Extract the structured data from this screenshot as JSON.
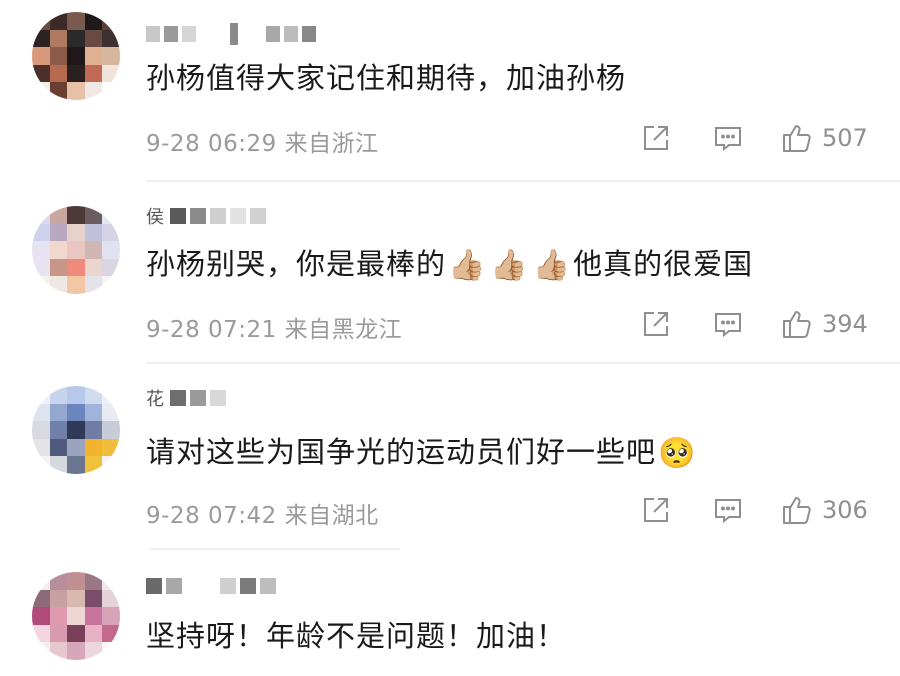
{
  "comments": [
    {
      "username": "",
      "text": "孙杨值得大家记住和期待，加油孙杨",
      "time": "9-28 06:29",
      "location": "来自浙江",
      "likes": "507",
      "emojis": []
    },
    {
      "username": "侯",
      "text_before": "孙杨别哭，你是最棒的",
      "text_after": "他真的很爱国",
      "time": "9-28 07:21",
      "location": "来自黑龙江",
      "likes": "394",
      "emojis": [
        "👍🏼",
        "👍🏼",
        "👍🏼"
      ]
    },
    {
      "username": "花",
      "text": "请对这些为国争光的运动员们好一些吧",
      "time": "9-28 07:42",
      "location": "来自湖北",
      "likes": "306",
      "emojis": [
        "🥺"
      ]
    },
    {
      "username": "",
      "text": "坚持呀！年龄不是问题！加油！",
      "time": "",
      "location": "",
      "likes": "",
      "emojis": []
    }
  ],
  "icons": {
    "share": "share-icon",
    "reply": "reply-icon",
    "like": "thumbs-up-icon"
  },
  "colors": {
    "text": "#1a1a1a",
    "meta": "#9a9a9a",
    "icon": "#8f8f8f",
    "divider": "#efefef"
  }
}
